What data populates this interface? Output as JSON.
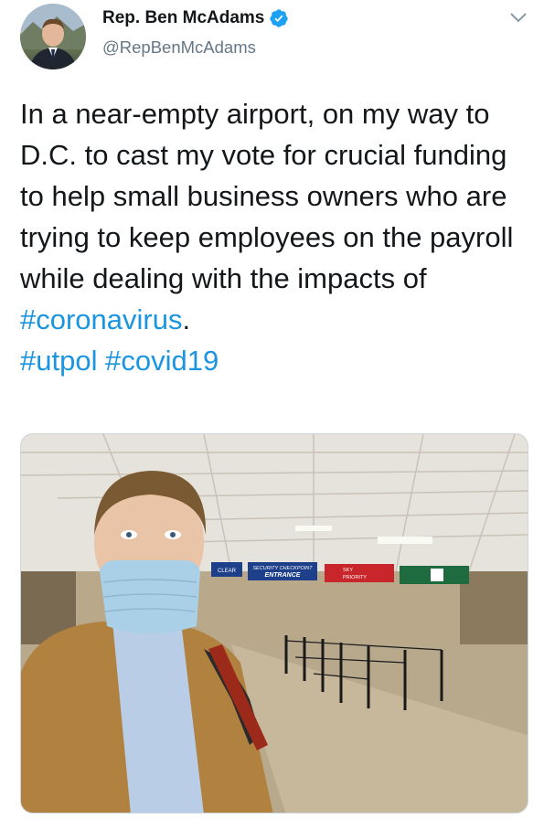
{
  "author": {
    "display_name": "Rep. Ben McAdams",
    "handle": "@RepBenMcAdams",
    "verified": true,
    "avatar_icon": "profile-photo"
  },
  "tweet": {
    "text_main": "In a near-empty airport, on my way to D.C. to cast my vote for crucial funding to help small business owners who are trying to keep employees on the payroll while dealing with the impacts of ",
    "hashtag_1": "#coronavirus",
    "text_after": ".",
    "hashtag_2": "#utpol",
    "hashtag_3": "#covid19"
  },
  "media": {
    "signs": {
      "security": "SECURITY CHECKPOINT",
      "entrance": "ENTRANCE",
      "sky": "SKY",
      "priority": "PRIORITY",
      "clear": "CLEAR"
    }
  },
  "colors": {
    "hashtag": "#1b95e0",
    "verified": "#1da1f2",
    "handle": "#657786"
  }
}
